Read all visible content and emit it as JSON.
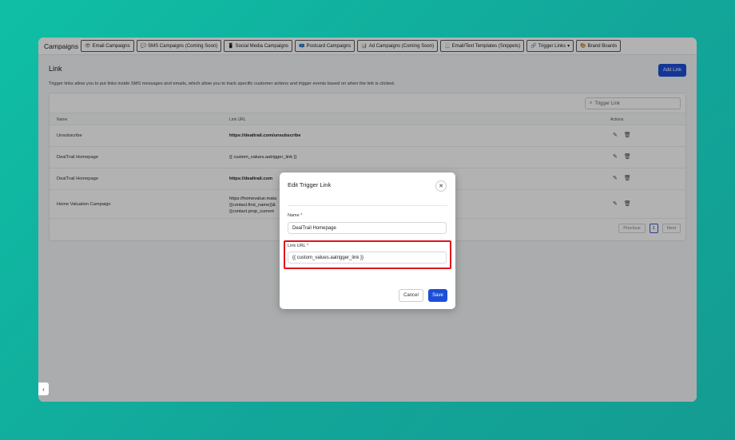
{
  "header": {
    "brand": "Campaigns",
    "tabs": [
      {
        "icon": "eye-icon",
        "glyph": "👁",
        "label": "Email Campaigns"
      },
      {
        "icon": "chat-icon",
        "glyph": "💬",
        "label": "SMS Campaigns (Coming Soon)"
      },
      {
        "icon": "phone-icon",
        "glyph": "📱",
        "label": "Social Media Campaigns"
      },
      {
        "icon": "postcard-icon",
        "glyph": "📪",
        "label": "Postcard Campaigns"
      },
      {
        "icon": "ad-icon",
        "glyph": "📊",
        "label": "Ad Campaigns (Coming Soon)"
      },
      {
        "icon": "template-icon",
        "glyph": "📃",
        "label": "Email/Text Templates (Snippets)"
      },
      {
        "icon": "link-icon",
        "glyph": "🔗",
        "label": "Trigger Links",
        "dropdown": "▾"
      },
      {
        "icon": "palette-icon",
        "glyph": "🎨",
        "label": "Brand Boards"
      }
    ]
  },
  "page": {
    "title": "Link",
    "add_button": "Add Link",
    "description": "Trigger links allow you to put links inside SMS messages and emails, which allow you to track specific customer actions and trigger events based on when the link is clicked.",
    "search_placeholder": "Trigger Link",
    "search_icon": "search-icon"
  },
  "table": {
    "columns": {
      "name": "Name",
      "url": "Link URL",
      "actions": "Actions"
    },
    "rows": [
      {
        "name": "Unsubscribe",
        "url": "https://dealtrail.com/unsubscribe"
      },
      {
        "name": "DealTrail Homepage",
        "url": "{{ custom_values.aatrigger_link }}"
      },
      {
        "name": "DealTrail Homepage",
        "url": "https://dealtrail.com"
      },
      {
        "name": "Home Valuation Campaign",
        "url_lines": [
          "https://homevalue.mata",
          "{{contact.first_name}}&",
          "{{contact.prop_current"
        ]
      }
    ],
    "pagination": {
      "previous": "Previous",
      "page": "1",
      "next": "Next"
    }
  },
  "modal": {
    "title": "Edit Trigger Link",
    "name_label": "Name",
    "name_value": "DealTrail Homepage",
    "url_label": "Link URL",
    "url_value": "{{ custom_values.aatrigger_link }}",
    "required_mark": "*",
    "cancel": "Cancel",
    "save": "Save"
  },
  "colors": {
    "accent": "#1d4ed8",
    "highlight": "#e0131a",
    "background": "#12a79a"
  }
}
